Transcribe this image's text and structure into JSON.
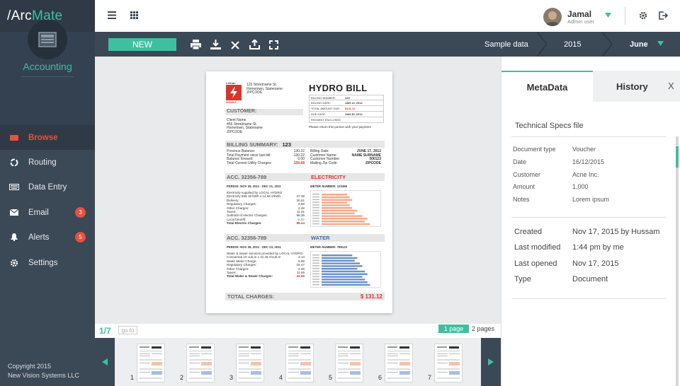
{
  "app": {
    "logo_prefix": "/Arc",
    "logo_suffix": "Mate"
  },
  "user": {
    "name": "Jamal",
    "role": "Admin user"
  },
  "sidebar": {
    "section": "Accounting",
    "items": [
      {
        "label": "Browse",
        "icon": "browse-icon"
      },
      {
        "label": "Routing",
        "icon": "routing-icon"
      },
      {
        "label": "Data Entry",
        "icon": "keyboard-icon"
      },
      {
        "label": "Email",
        "icon": "mail-icon",
        "badge": "3"
      },
      {
        "label": "Alerts",
        "icon": "bell-icon",
        "badge": "5"
      },
      {
        "label": "Settings",
        "icon": "gear-icon"
      }
    ],
    "copyright_1": "Copyright 2015",
    "copyright_2": "New Vision Systems LLC"
  },
  "toolbar": {
    "new_label": "NEW",
    "breadcrumb": [
      "Sample data",
      "2015",
      "June"
    ]
  },
  "pager": {
    "current": "1/7",
    "goto": "go to",
    "one_page": "1 page",
    "two_pages": "2 pages"
  },
  "thumbnails": [
    "1",
    "2",
    "3",
    "4",
    "5",
    "6",
    "7"
  ],
  "panel": {
    "tabs": [
      "MetaData",
      "History"
    ],
    "close": "X",
    "section_title": "Technical Specs file",
    "meta": [
      {
        "label": "Document type",
        "value": "Voucher"
      },
      {
        "label": "Date",
        "value": "16/12/2015"
      },
      {
        "label": "Customer",
        "value": "Acne Inc."
      },
      {
        "label": "Amount",
        "value": "1,000"
      },
      {
        "label": "Notes",
        "value": "Lorem ipsum"
      }
    ],
    "info": [
      {
        "label": "Created",
        "value": "Nov 17, 2015 by Hussam"
      },
      {
        "label": "Last modified",
        "value": "1:44 pm by me"
      },
      {
        "label": "Last opened",
        "value": "Nov 17, 2015"
      },
      {
        "label": "Type",
        "value": "Document"
      }
    ]
  },
  "bill": {
    "logo_text": "LOCAL",
    "logo_sub": "HYDRO",
    "address": [
      "123 Streetname St.",
      "Hometown, Statename",
      "ZIPCODE"
    ],
    "title": "HYDRO BILL",
    "fields": [
      {
        "label": "BILLING NUMBER:",
        "value": "123"
      },
      {
        "label": "BILLING DATE:",
        "value": "JAN 13, 2012"
      },
      {
        "label": "TOTAL AMOUNT DUE:",
        "value": "$131.12"
      },
      {
        "label": "DUE DATE:",
        "value": "JAN 30, 2012"
      },
      {
        "label": "PAYMENT ENCLOSED",
        "value": ""
      }
    ],
    "customer_label": "CUSTOMER:",
    "customer_lines": [
      "Client Name",
      "456 Streetname St.",
      "Hometown, Statename",
      "ZIPCODE"
    ],
    "return_note": "Please return this portion with your payment",
    "summary_label": "BILLING SUMMARY:",
    "summary_number": "123",
    "summary_left": [
      {
        "label": "Previous Balance:",
        "value": "130.22"
      },
      {
        "label": "Total Payment since last bill:",
        "value": "-130.22"
      },
      {
        "label": "Balance forward:",
        "value": "0.00"
      },
      {
        "label": "Total Current Utility Charges:",
        "value": "159.68"
      }
    ],
    "summary_right": [
      {
        "label": "Billing Date:",
        "value": "JUNE 17, 2012"
      },
      {
        "label": "Customer Name:",
        "value": "NAME SURNAME"
      },
      {
        "label": "Customer Number:",
        "value": "000123"
      },
      {
        "label": "Mailing Zip Code:",
        "value": "ZIPCODE"
      }
    ],
    "acc_label": "ACC. 32356-789",
    "electricity": "ELECTRICITY",
    "water": "WATER",
    "elec_period": "PERIOD: NOV 26, 2011 - DEC 21, 2011",
    "elec_meter": "METER NUMBER: 123456",
    "elec_lines": [
      {
        "label": "Electricity supplied by LOCAL HYDRO",
        "value": ""
      },
      {
        "label": "Electricity 658.18 kWh x 14.66 ¢/kWh",
        "value": "47.39"
      },
      {
        "label": "Delivery:",
        "value": "30.61"
      },
      {
        "label": "Regulatory Charges:",
        "value": "4.58"
      },
      {
        "label": "Other Charges:",
        "value": "4.48"
      },
      {
        "label": "Taxes:",
        "value": "11.31"
      },
      {
        "label": "Subtotal of electric Charges:",
        "value": "98.36"
      },
      {
        "label": "Local benefit:",
        "value": "-9.92"
      },
      {
        "label": "Total Electric Charges:",
        "value": "88.44"
      }
    ],
    "water_period": "PERIOD: NOV 26, 2011 - DEC 23, 2011",
    "water_meter": "METER NUMBER: 789123",
    "water_lines": [
      {
        "label": "Water & sewer services provided by LOCAL HYDRO",
        "value": ""
      },
      {
        "label": "Consumed 10 cub.m x 31.45 ¢/cub.m",
        "value": "3.14"
      },
      {
        "label": "Water Meter Charge:",
        "value": "8.59"
      },
      {
        "label": "Regulatory Charges:",
        "value": "15.47"
      },
      {
        "label": "Other Charges:",
        "value": "4.48"
      },
      {
        "label": "Taxes:",
        "value": "11.65"
      },
      {
        "label": "Total Water & Sewer Charges:",
        "value": "42.66"
      }
    ],
    "total_label": "TOTAL CHARGES:",
    "total_value": "$ 131.12",
    "elec_bars": [
      0.5,
      0.55,
      0.6,
      0.5,
      0.55,
      0.6,
      0.7,
      0.65,
      0.8,
      0.9,
      0.85,
      0.95
    ],
    "water_bars": [
      0.6,
      0.7,
      0.65,
      0.75,
      0.8,
      0.7,
      0.85,
      0.9,
      0.8,
      0.85,
      0.9,
      0.95
    ]
  },
  "colors": {
    "accent": "#3ec0a0",
    "danger": "#e8503f",
    "sidebar": "#3b4856",
    "elec": "#f4a886",
    "water": "#6a8fc7"
  }
}
